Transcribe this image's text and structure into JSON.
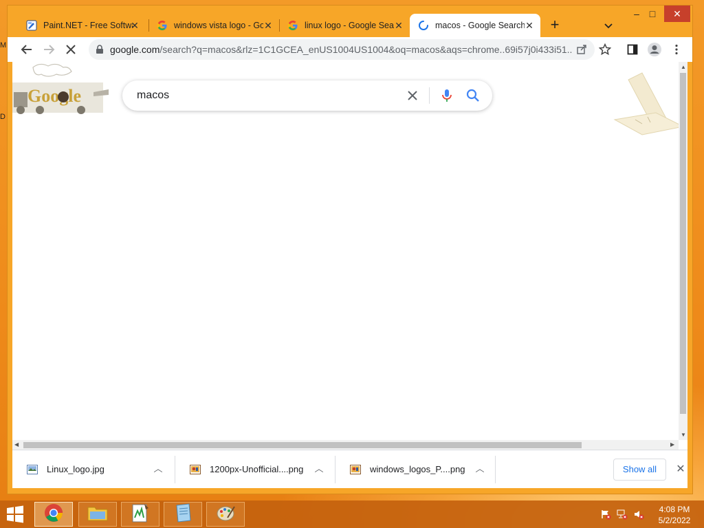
{
  "desktop": {
    "edge_letter_1": "M",
    "edge_letter_2": "D"
  },
  "browser": {
    "tabs": [
      {
        "label": "Paint.NET - Free Software",
        "icon": "paintnet-icon",
        "active": false
      },
      {
        "label": "windows vista logo - Google Search",
        "icon": "google-g-icon",
        "active": false
      },
      {
        "label": "linux logo - Google Search",
        "icon": "google-g-icon",
        "active": false
      },
      {
        "label": "macos - Google Search",
        "icon": "loading-spinner-icon",
        "active": true
      }
    ],
    "new_tab_symbol": "+",
    "window_controls": {
      "minimize": "–",
      "maximize": "□",
      "close": "✕"
    },
    "address_bar": {
      "host": "google.com",
      "path": "/search?q=macos&rlz=1C1GCEA_enUS1004US1004&oq=macos&aqs=chrome..69i57j0i433i51...",
      "secure_icon": "lock-icon"
    }
  },
  "page": {
    "logo_text": "Google",
    "search_value": "macos",
    "accent_colors": {
      "mic_blue": "#4285f4",
      "mic_red": "#ea4335",
      "search_blue": "#4285f4"
    }
  },
  "downloads": {
    "items": [
      {
        "name": "Linux_logo.jpg",
        "icon": "image-file-icon"
      },
      {
        "name": "1200px-Unofficial....png",
        "icon": "png-file-icon"
      },
      {
        "name": "windows_logos_P....png",
        "icon": "png-file-icon"
      }
    ],
    "show_all_label": "Show all"
  },
  "taskbar": {
    "apps": [
      {
        "name": "chrome-app",
        "active": true
      },
      {
        "name": "file-explorer-app",
        "active": false
      },
      {
        "name": "notepadpp-app",
        "active": false
      },
      {
        "name": "notepad-app",
        "active": false
      },
      {
        "name": "paint-app",
        "active": false
      }
    ],
    "clock": {
      "time": "4:08 PM",
      "date": "5/2/2022"
    }
  }
}
